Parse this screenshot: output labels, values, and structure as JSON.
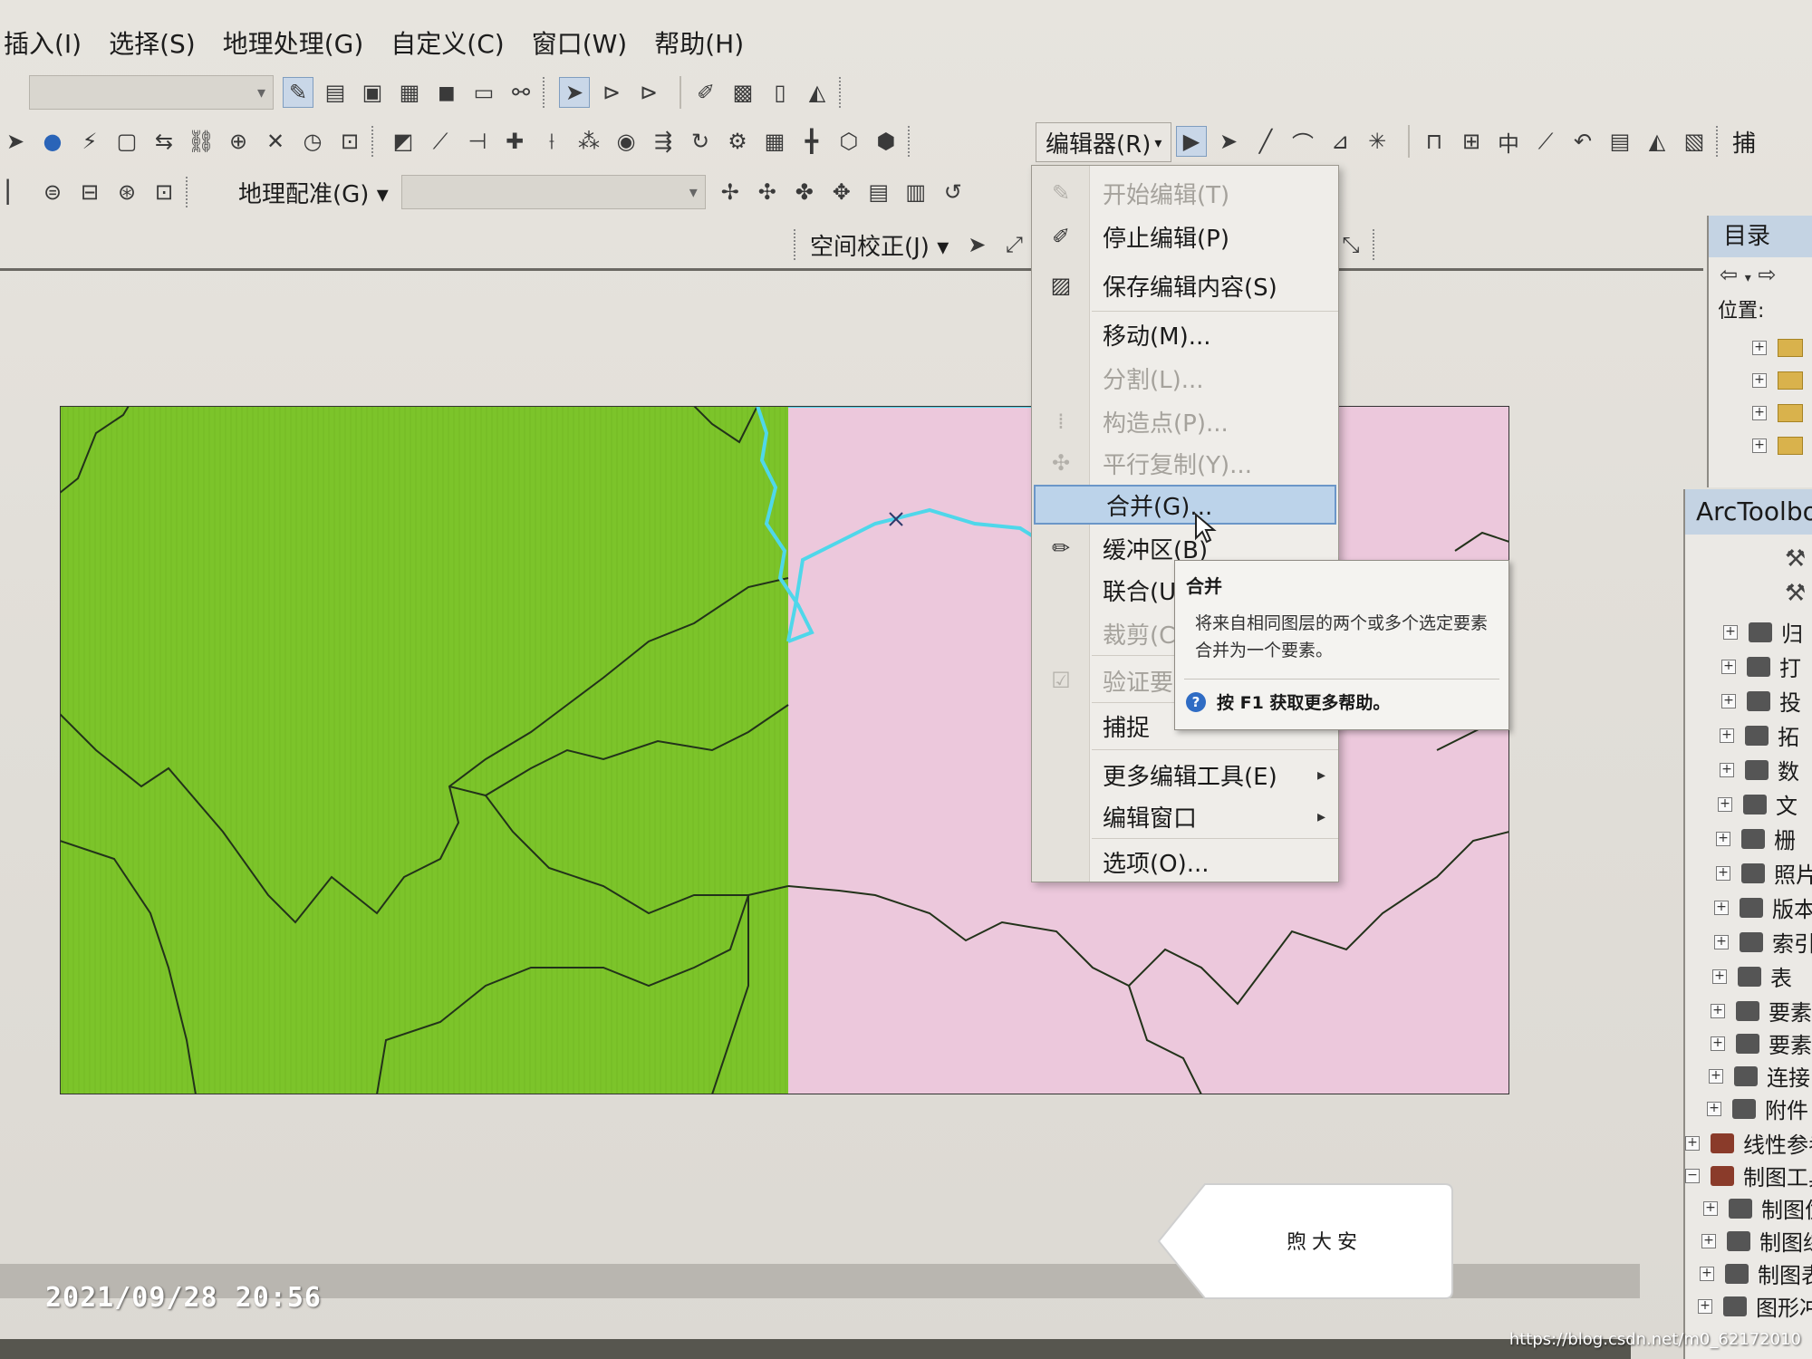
{
  "menubar": [
    "插入(I)",
    "选择(S)",
    "地理处理(G)",
    "自定义(C)",
    "窗口(W)",
    "帮助(H)"
  ],
  "toolbar": {
    "georef_label": "地理配准(G)",
    "spatial_adjust_label": "空间校正(J)",
    "editor_label": "编辑器(R)",
    "right_cut_label": "捕"
  },
  "editor_menu": {
    "items": [
      {
        "label": "开始编辑(T)",
        "icon": "pencil-icon"
      },
      {
        "label": "停止编辑(P)",
        "icon": "stop-edit-icon"
      },
      {
        "label": "保存编辑内容(S)",
        "icon": "save-edits-icon"
      },
      {
        "label": "移动(M)...",
        "icon": ""
      },
      {
        "label": "分割(L)...",
        "icon": ""
      },
      {
        "label": "构造点(P)...",
        "icon": "construct-points-icon"
      },
      {
        "label": "平行复制(Y)...",
        "icon": "copy-parallel-icon"
      },
      {
        "label": "合并(G)...",
        "icon": ""
      },
      {
        "label": "缓冲区(B)",
        "icon": "buffer-icon"
      },
      {
        "label": "联合(U)",
        "icon": ""
      },
      {
        "label": "裁剪(C)",
        "icon": ""
      },
      {
        "label": "验证要素",
        "icon": "validate-icon"
      },
      {
        "label": "捕捉",
        "icon": ""
      },
      {
        "label": "更多编辑工具(E)",
        "icon": ""
      },
      {
        "label": "编辑窗口",
        "icon": ""
      },
      {
        "label": "选项(O)...",
        "icon": ""
      }
    ]
  },
  "tooltip": {
    "title": "合并",
    "body": "将来自相同图层的两个或多个选定要素合并为一个要素。",
    "help": "按 F1 获取更多帮助。"
  },
  "catalog": {
    "title": "目录",
    "location_label": "位置:"
  },
  "toolbox": {
    "title": "ArcToolbox",
    "items": [
      "归",
      "打",
      "投",
      "拓",
      "数",
      "文",
      "栅",
      "照片",
      "版本",
      "索引",
      "表",
      "要素",
      "要素",
      "连接",
      "附件",
      "线性参考",
      "制图工具",
      "制图优",
      "制图综",
      "制图表",
      "图形冲"
    ]
  },
  "signpost_text": "煦大安",
  "timestamp": "2021/09/28 20:56",
  "watermark": "https://blog.csdn.net/m0_62172010",
  "colors": {
    "green_polygon": "#7cc42a",
    "pink_polygon": "#ecc8dc",
    "selection_cyan": "#4fd7ea",
    "menu_highlight": "#bcd3ea"
  }
}
